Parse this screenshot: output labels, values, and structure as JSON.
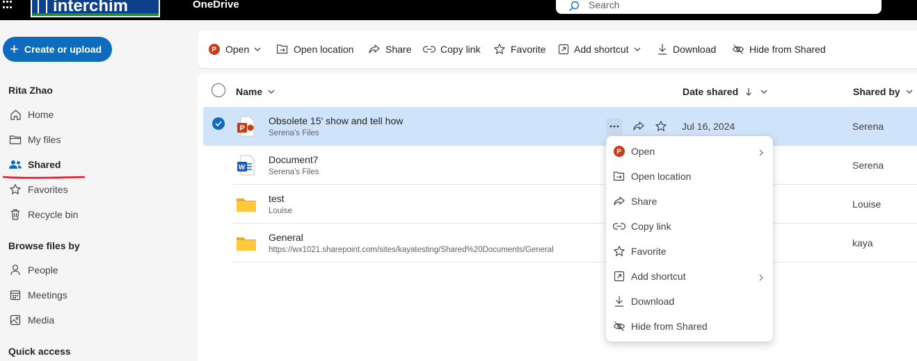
{
  "topbar": {
    "logo_text": "interchim",
    "app_name": "OneDrive",
    "search_placeholder": "Search"
  },
  "sidebar": {
    "create_label": "Create or upload",
    "user_name": "Rita Zhao",
    "nav": [
      {
        "label": "Home",
        "icon": "home-icon"
      },
      {
        "label": "My files",
        "icon": "folder-icon"
      },
      {
        "label": "Shared",
        "icon": "people-icon",
        "active": true
      },
      {
        "label": "Favorites",
        "icon": "star-icon"
      },
      {
        "label": "Recycle bin",
        "icon": "trash-icon"
      }
    ],
    "browse_heading": "Browse files by",
    "browse": [
      {
        "label": "People",
        "icon": "person-icon"
      },
      {
        "label": "Meetings",
        "icon": "calendar-icon"
      },
      {
        "label": "Media",
        "icon": "image-icon"
      }
    ],
    "quick_access_heading": "Quick access",
    "annotation_color": "#e81123"
  },
  "toolbar": {
    "open": "Open",
    "open_location": "Open location",
    "share": "Share",
    "copy_link": "Copy link",
    "favorite": "Favorite",
    "add_shortcut": "Add shortcut",
    "download": "Download",
    "hide_from_shared": "Hide from Shared"
  },
  "table": {
    "col_name": "Name",
    "col_date": "Date shared",
    "col_shared_by": "Shared by",
    "rows": [
      {
        "name": "Obsolete 15' show and tell how",
        "location": "Serena's Files",
        "date": "Jul 16, 2024",
        "shared_by": "Serena",
        "type": "powerpoint",
        "selected": true
      },
      {
        "name": "Document7",
        "location": "Serena's Files",
        "date": "",
        "shared_by": "Serena",
        "type": "word"
      },
      {
        "name": "test",
        "location": "Louise",
        "date": "",
        "shared_by": "Louise",
        "type": "folder"
      },
      {
        "name": "General",
        "location": "https://wx1021.sharepoint.com/sites/kayatesting/Shared%20Documents/General",
        "date": "",
        "shared_by": "kaya",
        "type": "folder"
      }
    ]
  },
  "context_menu": {
    "items": [
      {
        "label": "Open",
        "icon": "powerpoint-icon",
        "submenu": true
      },
      {
        "label": "Open location",
        "icon": "open-location-icon"
      },
      {
        "label": "Share",
        "icon": "share-icon"
      },
      {
        "label": "Copy link",
        "icon": "link-icon"
      },
      {
        "label": "Favorite",
        "icon": "star-icon"
      },
      {
        "label": "Add shortcut",
        "icon": "add-shortcut-icon",
        "submenu": true
      },
      {
        "label": "Download",
        "icon": "download-icon"
      },
      {
        "label": "Hide from Shared",
        "icon": "eye-off-icon"
      }
    ]
  },
  "colors": {
    "accent": "#0f6cbd",
    "selected_row": "#cfe4fa",
    "powerpoint": "#c43e1c",
    "word": "#185abd",
    "folder": "#ffc83d"
  }
}
